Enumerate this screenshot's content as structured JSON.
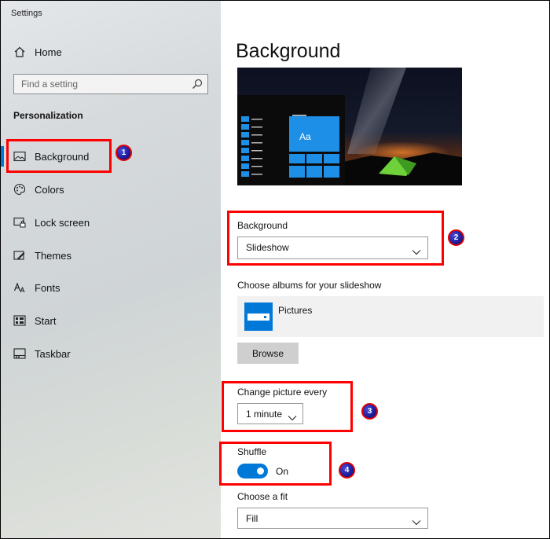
{
  "app": {
    "title": "Settings"
  },
  "sidebar": {
    "home_label": "Home",
    "search_placeholder": "Find a setting",
    "section_heading": "Personalization",
    "items": [
      {
        "label": "Background",
        "icon": "picture-icon",
        "active": true
      },
      {
        "label": "Colors",
        "icon": "palette-icon"
      },
      {
        "label": "Lock screen",
        "icon": "lock-screen-icon"
      },
      {
        "label": "Themes",
        "icon": "brush-icon"
      },
      {
        "label": "Fonts",
        "icon": "fonts-icon"
      },
      {
        "label": "Start",
        "icon": "start-icon"
      },
      {
        "label": "Taskbar",
        "icon": "taskbar-icon"
      }
    ]
  },
  "main": {
    "page_title": "Background",
    "preview": {
      "tile_text": "Aa"
    },
    "background_setting": {
      "label": "Background",
      "value": "Slideshow"
    },
    "albums": {
      "label": "Choose albums for your slideshow",
      "album_name": "Pictures",
      "browse_label": "Browse"
    },
    "interval": {
      "label": "Change picture every",
      "value": "1 minute"
    },
    "shuffle": {
      "label": "Shuffle",
      "state": "On",
      "on": true
    },
    "fit": {
      "label": "Choose a fit",
      "value": "Fill"
    }
  },
  "annotations": [
    "1",
    "2",
    "3",
    "4"
  ],
  "colors": {
    "accent": "#0078d7",
    "highlight": "#ff0000",
    "badge": "#1b1b9a"
  }
}
